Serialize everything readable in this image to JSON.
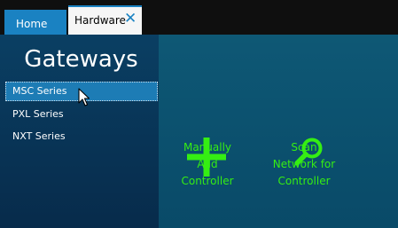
{
  "tabs": {
    "home": "Home",
    "hardware": "Hardware",
    "close_glyph": "✕"
  },
  "sidebar": {
    "title": "Gateways",
    "items": [
      {
        "label": "MSC Series",
        "selected": true
      },
      {
        "label": "PXL Series",
        "selected": false
      },
      {
        "label": "NXT Series",
        "selected": false
      }
    ]
  },
  "actions": {
    "add": {
      "label": "Manually\nAdd\nController",
      "icon": "plus-icon"
    },
    "scan": {
      "label": "Scan\nNetwork for\nController",
      "icon": "magnifier-icon"
    }
  },
  "colors": {
    "accent": "#1a82c2",
    "action_green": "#35ee13"
  }
}
